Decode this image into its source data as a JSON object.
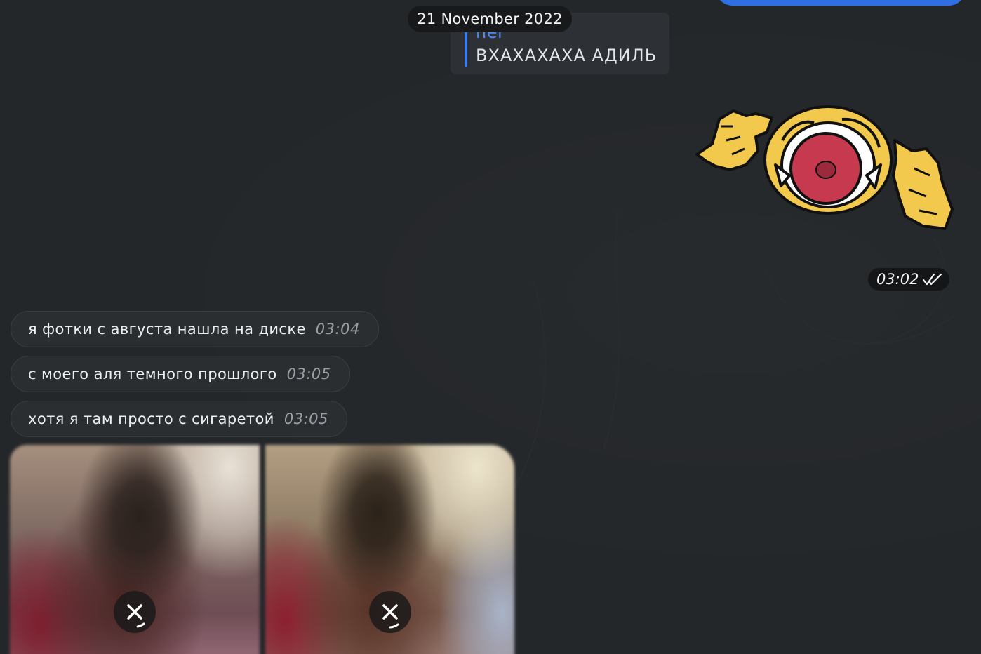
{
  "date_separator": "21 November 2022",
  "reply_preview": {
    "author": "nel",
    "text": "ВХАХАХАХА АДИЛЬ"
  },
  "sticker": {
    "icon": "laughing-face-sticker",
    "time": "03:02",
    "status_icon": "double-check-icon"
  },
  "messages": [
    {
      "text": "я фотки с августа нашла на диске",
      "time": "03:04"
    },
    {
      "text": "с моего аля темного прошлого",
      "time": "03:05"
    },
    {
      "text": "хотя я там просто с сигаретой",
      "time": "03:05"
    }
  ],
  "photos": [
    {
      "icon": "cancel-download-icon"
    },
    {
      "icon": "cancel-download-icon"
    }
  ],
  "colors": {
    "background": "#24272a",
    "accent": "#2f6fe4",
    "reply_bar": "#3a7bf0",
    "bubble": "#2b2e31"
  }
}
